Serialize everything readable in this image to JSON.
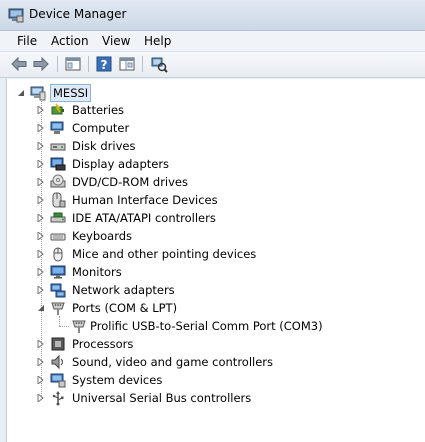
{
  "window": {
    "title": "Device Manager"
  },
  "menu": [
    "File",
    "Action",
    "View",
    "Help"
  ],
  "toolbar": [
    "back-icon",
    "forward-icon",
    "properties-icon",
    "help-icon",
    "console-tree-icon",
    "scan-hardware-icon"
  ],
  "tree": {
    "root": "MESSI",
    "categories": [
      {
        "label": "Batteries",
        "icon": "battery-icon",
        "expanded": false
      },
      {
        "label": "Computer",
        "icon": "computer-icon",
        "expanded": false
      },
      {
        "label": "Disk drives",
        "icon": "disk-drive-icon",
        "expanded": false
      },
      {
        "label": "Display adapters",
        "icon": "display-adapter-icon",
        "expanded": false
      },
      {
        "label": "DVD/CD-ROM drives",
        "icon": "dvd-drive-icon",
        "expanded": false
      },
      {
        "label": "Human Interface Devices",
        "icon": "hid-icon",
        "expanded": false
      },
      {
        "label": "IDE ATA/ATAPI controllers",
        "icon": "ide-controller-icon",
        "expanded": false
      },
      {
        "label": "Keyboards",
        "icon": "keyboard-icon",
        "expanded": false
      },
      {
        "label": "Mice and other pointing devices",
        "icon": "mouse-icon",
        "expanded": false
      },
      {
        "label": "Monitors",
        "icon": "monitor-icon",
        "expanded": false
      },
      {
        "label": "Network adapters",
        "icon": "network-adapter-icon",
        "expanded": false
      },
      {
        "label": "Ports (COM & LPT)",
        "icon": "port-icon",
        "expanded": true,
        "children": [
          {
            "label": "Prolific USB-to-Serial Comm Port (COM3)",
            "icon": "port-icon"
          }
        ]
      },
      {
        "label": "Processors",
        "icon": "processor-icon",
        "expanded": false
      },
      {
        "label": "Sound, video and game controllers",
        "icon": "sound-icon",
        "expanded": false
      },
      {
        "label": "System devices",
        "icon": "system-device-icon",
        "expanded": false
      },
      {
        "label": "Universal Serial Bus controllers",
        "icon": "usb-icon",
        "expanded": false
      }
    ]
  },
  "colors": {
    "selection_bg": "#dfeaf7",
    "selection_border": "#8fb3d8",
    "titlebar": "#dfe8f2"
  }
}
